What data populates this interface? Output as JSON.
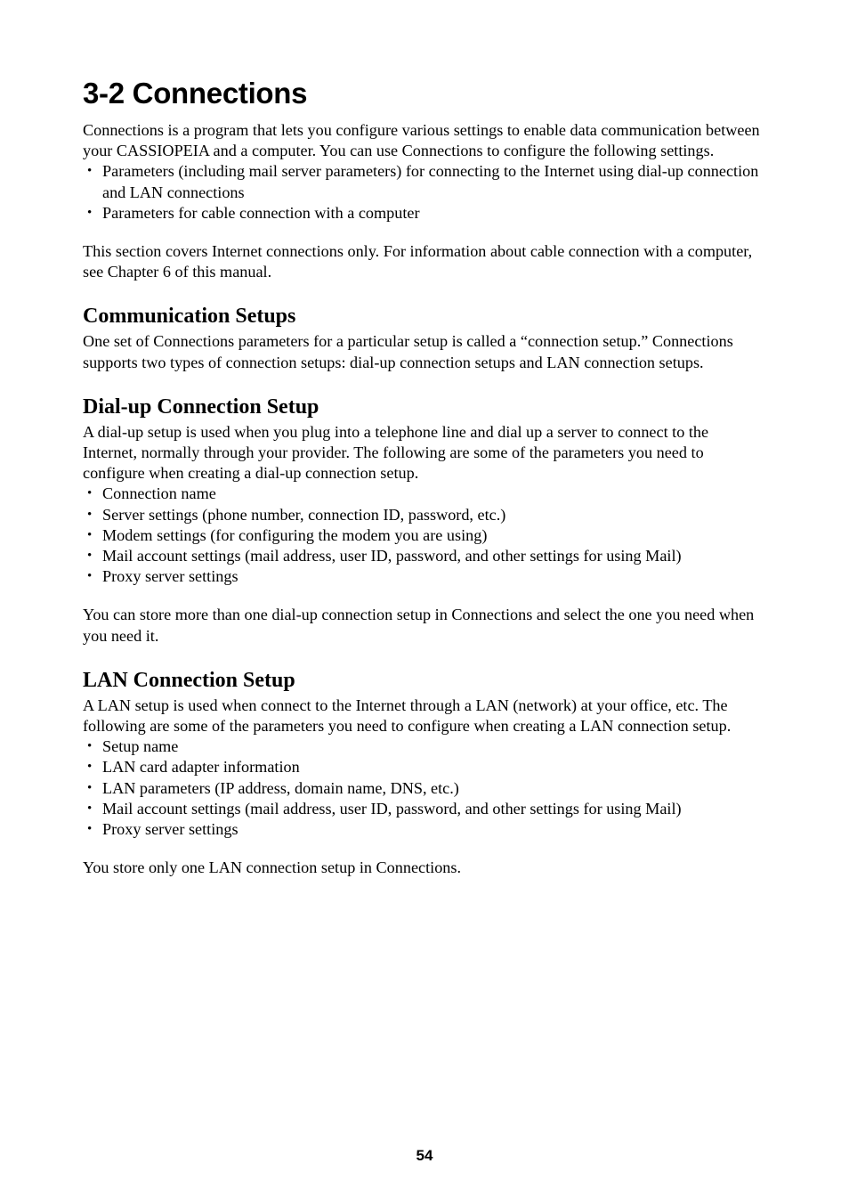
{
  "page": {
    "number": "54",
    "title": "3-2 Connections"
  },
  "intro": {
    "paragraph": "Connections is a program that lets you configure various settings to enable data communication between your CASSIOPEIA and a computer. You can use Connections to configure the following settings.",
    "bullets": [
      "Parameters (including mail server parameters) for connecting to the Internet using dial-up connection and LAN connections",
      "Parameters for cable connection with a computer"
    ],
    "note": "This section covers Internet connections only. For information about cable connection with a computer, see Chapter 6 of this manual."
  },
  "communication_setups": {
    "heading": "Communication Setups",
    "paragraph": "One set of Connections parameters for a particular setup is called a “connection setup.” Connections supports two types of connection setups: dial-up connection setups and LAN connection setups."
  },
  "dialup_setup": {
    "heading": "Dial-up Connection Setup",
    "paragraph": "A dial-up setup is used when you plug into a telephone line and dial up a server to connect to the Internet, normally through your provider. The following are some of the parameters you need to configure when creating a dial-up connection setup.",
    "bullets": [
      "Connection name",
      "Server settings (phone number, connection ID, password, etc.)",
      "Modem settings (for configuring the modem you are using)",
      "Mail account settings (mail address, user ID, password, and other settings for using Mail)",
      "Proxy server settings"
    ],
    "note": "You can store more than one dial-up connection setup in Connections and select the one you need when you need it."
  },
  "lan_setup": {
    "heading": "LAN Connection Setup",
    "paragraph": "A LAN setup is used when connect to the Internet through a LAN (network) at your office, etc. The following are some of the parameters you need to configure when creating a LAN connection setup.",
    "bullets": [
      "Setup name",
      "LAN card adapter information",
      "LAN parameters (IP address, domain name, DNS, etc.)",
      "Mail account settings (mail address, user ID, password, and other settings for using Mail)",
      "Proxy server settings"
    ],
    "note": "You store only one LAN connection setup in Connections."
  },
  "bullet_glyph": "•"
}
